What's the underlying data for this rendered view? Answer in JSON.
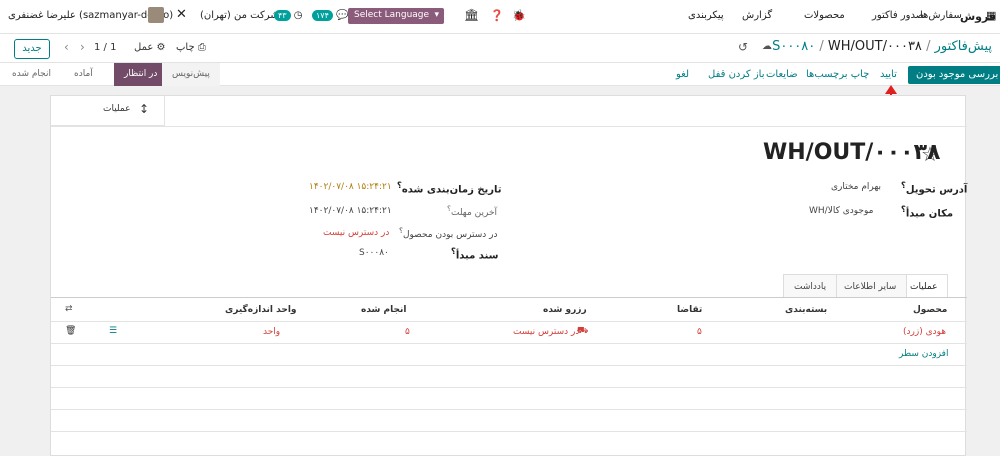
{
  "navbar": {
    "app_name": "فروش",
    "menu": [
      "سفارش‌ها",
      "صدور فاکتور",
      "محصولات",
      "گزارش",
      "پیکربندی"
    ],
    "company": "شرکت من (تهران)",
    "clock_badge": "۴۳",
    "chat_badge": "۱۷۴",
    "language_select": "Select Language",
    "user": "علیرضا غضنفری (sazmanyar-demo)"
  },
  "control": {
    "new_label": "جدید",
    "pager": "1 / 1",
    "action_label": "عمل",
    "print_label": "چاپ",
    "breadcrumb_parent": "پیش‌فاکتور",
    "breadcrumb_order": "S۰۰۰۸۰",
    "breadcrumb_current": "WH/OUT/۰۰۰۳۸",
    "separator": "/"
  },
  "statusbar": {
    "check_availability": "بررسی موجود بودن",
    "validate": "تایید",
    "print_labels": "چاپ برچسب‌ها",
    "scrap": "ضایعات",
    "unlock": "باز کردن قفل",
    "cancel": "لغو",
    "stages": [
      "پیش‌نویس",
      "در انتظار",
      "آماده",
      "انجام شده"
    ],
    "active_stage": "در انتظار"
  },
  "sheet": {
    "operations_button": "عملیات",
    "title": "WH/OUT/۰۰۰۳۸",
    "fields_right": [
      {
        "label": "آدرس تحویل",
        "value": "بهرام مختاری"
      },
      {
        "label": "مکان مبدأ",
        "value": "WH/موجودی کالا"
      }
    ],
    "fields_left": [
      {
        "label": "تاریخ زمان‌بندی شده",
        "value": "۱۴۰۲/۰۷/۰۸ ۱۵:۲۴:۲۱"
      },
      {
        "label": "آخرین مهلت",
        "value": "۱۴۰۲/۰۷/۰۸ ۱۵:۲۴:۲۱"
      },
      {
        "label": "در دسترس بودن محصول",
        "value": "در دسترس نیست"
      },
      {
        "label": "سند مبدأ",
        "value": "S۰۰۰۸۰"
      }
    ],
    "tabs": [
      "عملیات",
      "سایر اطلاعات",
      "یادداشت"
    ],
    "table": {
      "headers": [
        "محصول",
        "بسته‌بندی",
        "تقاضا",
        "رزرو شده",
        "انجام شده",
        "واحد اندازه‌گیری"
      ],
      "row": {
        "product": "هودی (زرد)",
        "demand": "۵",
        "reserved": "در دسترس نیست",
        "done": "۵",
        "uom": "واحد"
      },
      "add_line": "افزودن سطر"
    }
  },
  "colors": {
    "primary": "#017e84",
    "accent": "#714b67",
    "danger": "#d23f3a",
    "warning": "#b07d0e"
  }
}
